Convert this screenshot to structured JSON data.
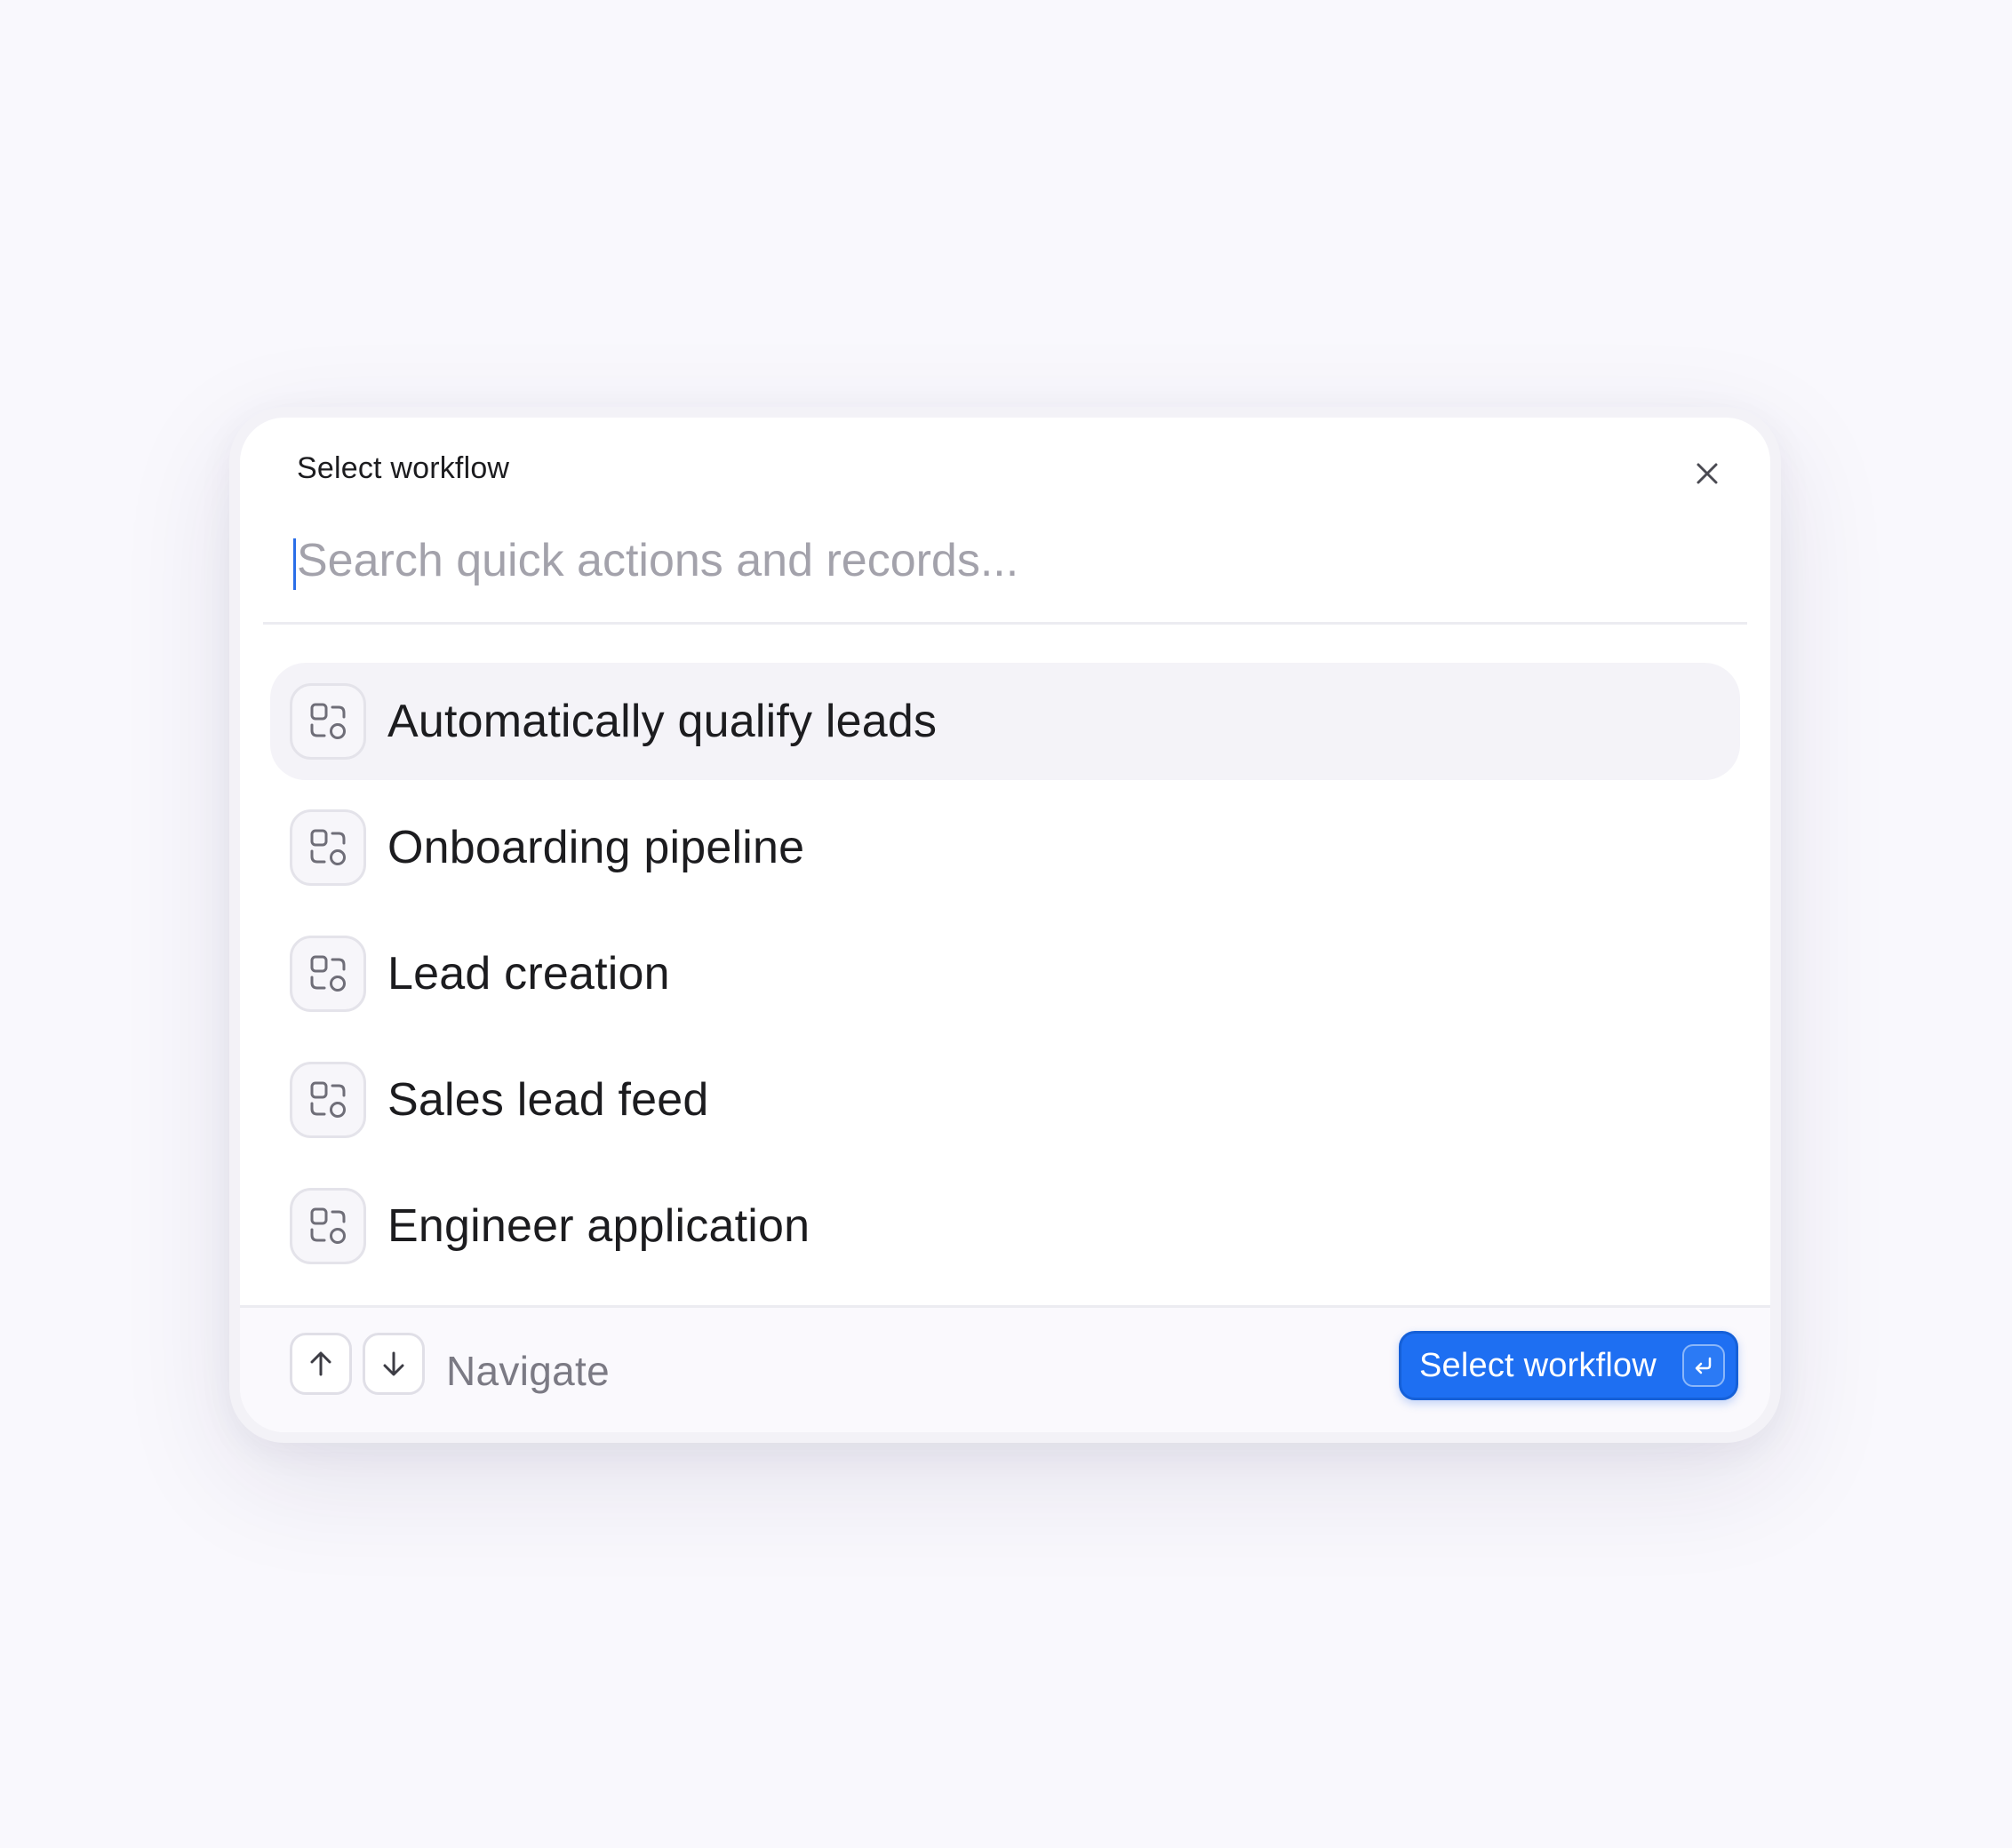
{
  "dialog": {
    "title": "Select workflow",
    "close_icon": "close-icon",
    "search": {
      "value": "",
      "placeholder": "Search quick actions and records..."
    },
    "items": [
      {
        "label": "Automatically qualify leads",
        "icon": "workflow-icon",
        "active": true
      },
      {
        "label": "Onboarding pipeline",
        "icon": "workflow-icon",
        "active": false
      },
      {
        "label": "Lead creation",
        "icon": "workflow-icon",
        "active": false
      },
      {
        "label": "Sales lead feed",
        "icon": "workflow-icon",
        "active": false
      },
      {
        "label": "Engineer application",
        "icon": "workflow-icon",
        "active": false
      }
    ],
    "footer": {
      "up_key_icon": "arrow-up-icon",
      "down_key_icon": "arrow-down-icon",
      "navigate_label": "Navigate",
      "primary_label": "Select workflow",
      "enter_key_icon": "enter-icon"
    }
  },
  "colors": {
    "background": "#f9f8fd",
    "accent": "#1e6ff2",
    "active_row": "#f4f3f8",
    "text": "#1c1c1f",
    "muted": "#7b7a84",
    "placeholder": "#a3a2ab"
  }
}
